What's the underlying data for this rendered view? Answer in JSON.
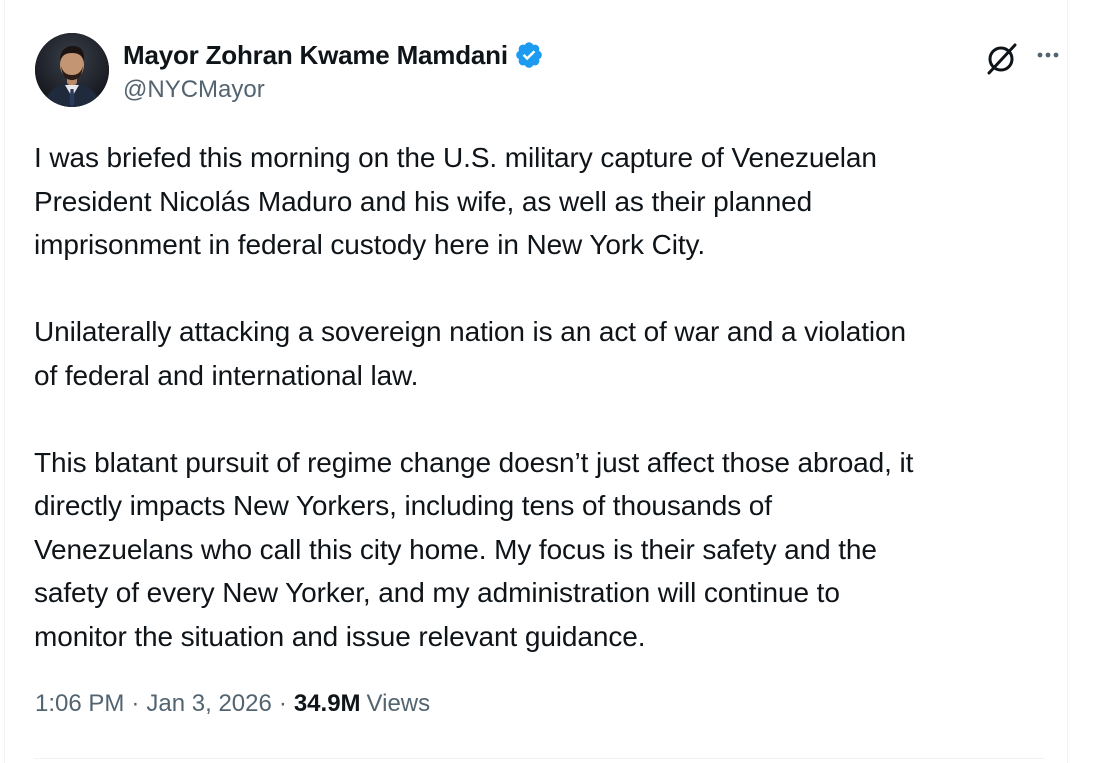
{
  "author": {
    "display_name": "Mayor Zohran Kwame Mamdani",
    "handle": "@NYCMayor",
    "verified_badge_color": "#1d9bf0"
  },
  "actions": {
    "grok_icon": "grok-icon",
    "more_icon": "more-icon"
  },
  "tweet": {
    "paragraphs": [
      "I was briefed this morning on the U.S. military capture of Venezuelan\nPresident Nicolás Maduro and his wife, as well as their planned\nimprisonment in federal custody here in New York City.",
      "Unilaterally attacking a sovereign nation is an act of war and a violation\nof federal and international law.",
      "This blatant pursuit of regime change doesn’t just affect those abroad, it\ndirectly impacts New Yorkers, including tens of thousands of\nVenezuelans who call this city home. My focus is their safety and the\nsafety of every New Yorker, and my administration will continue to\nmonitor the situation and issue relevant guidance."
    ]
  },
  "meta": {
    "time": "1:06 PM",
    "separator": "·",
    "date": "Jan 3, 2026",
    "views_count": "34.9M",
    "views_label": "Views"
  },
  "colors": {
    "text_primary": "#0f1419",
    "text_secondary": "#536471",
    "accent": "#1d9bf0"
  }
}
